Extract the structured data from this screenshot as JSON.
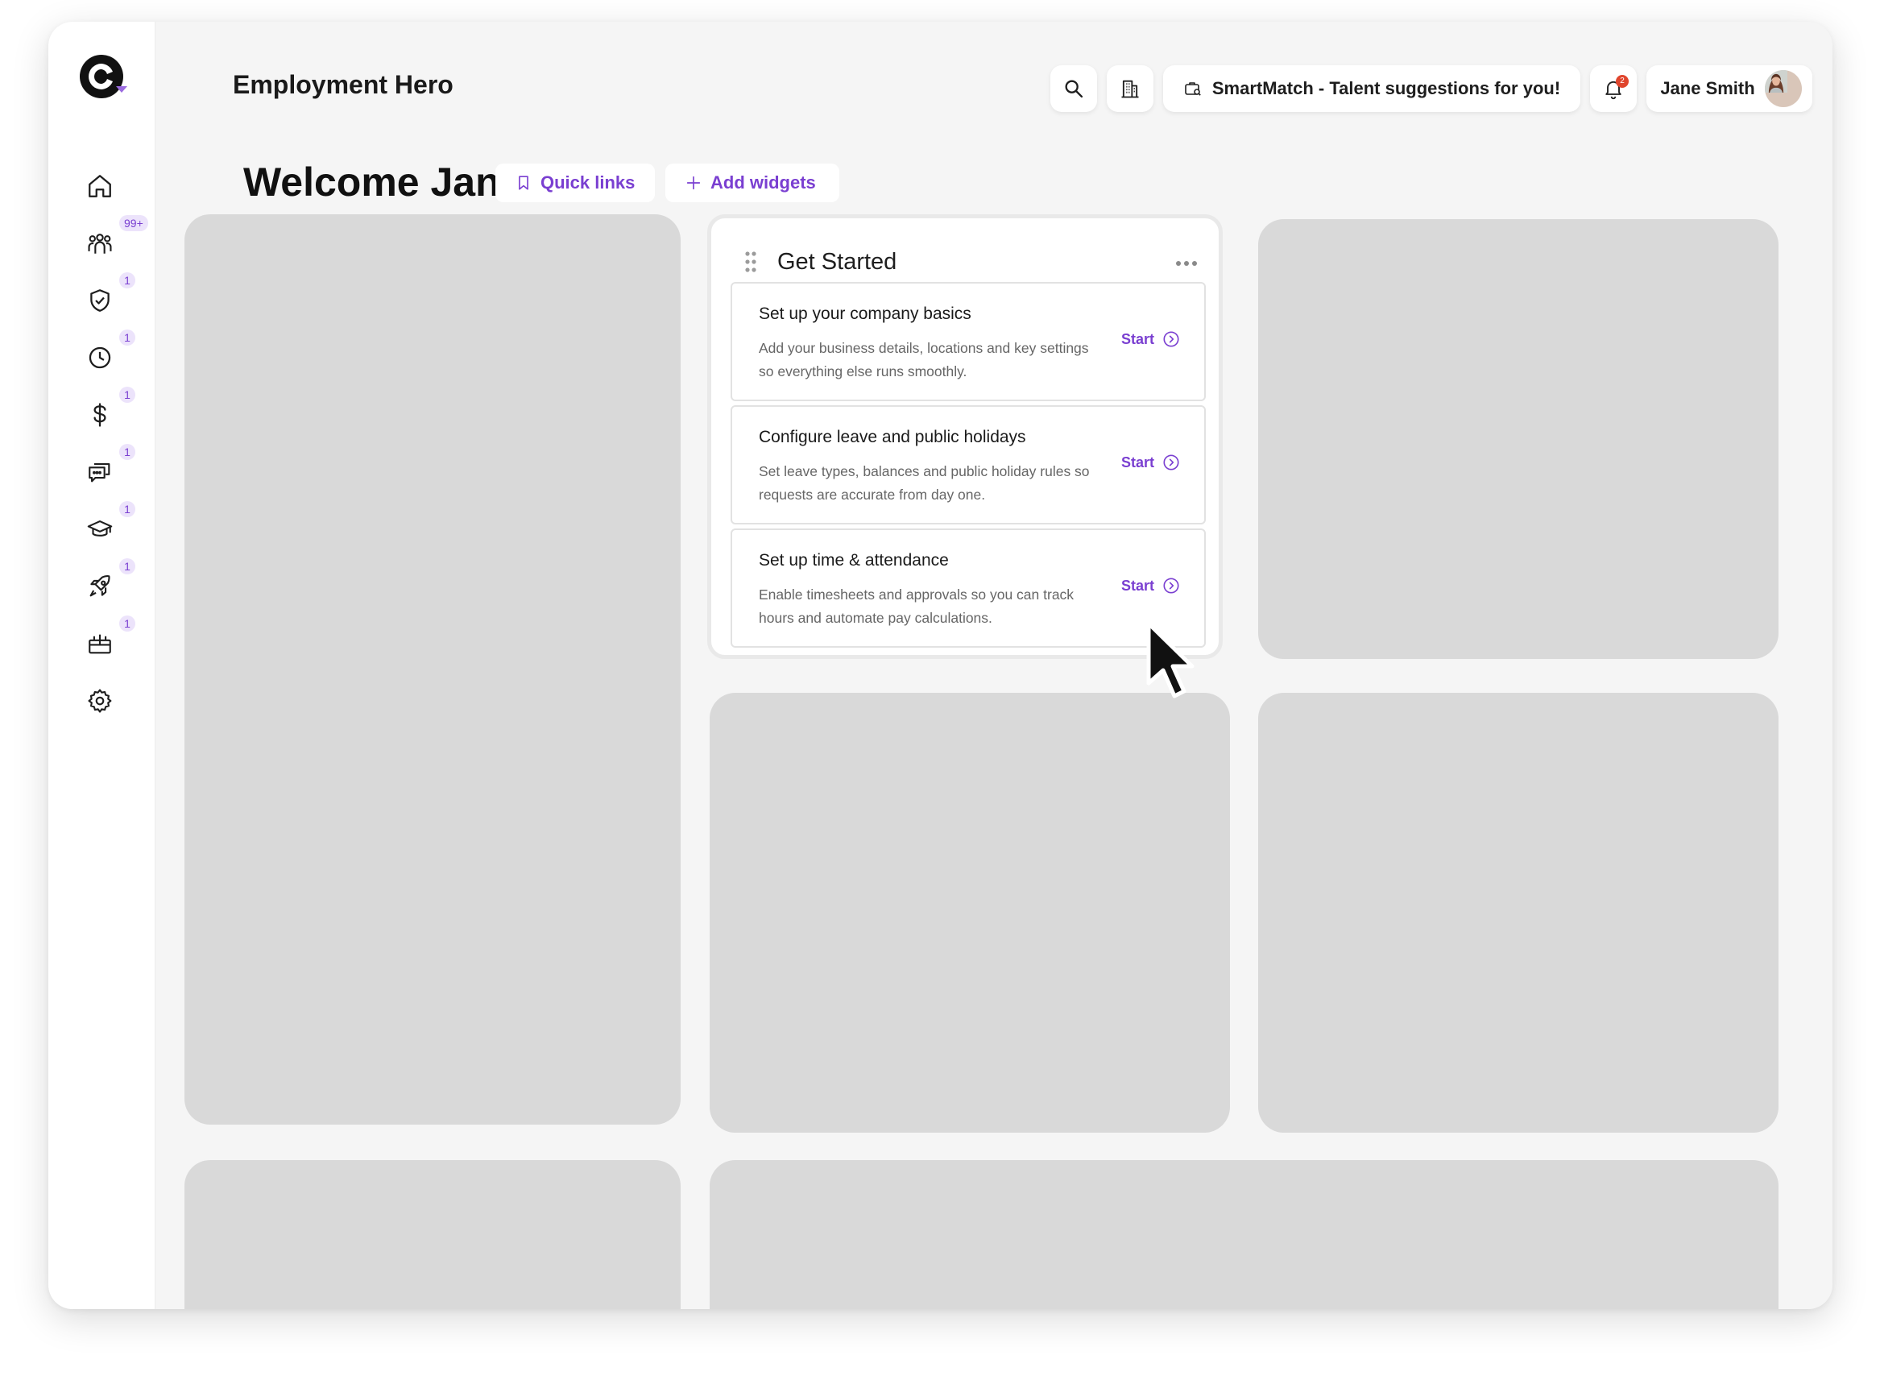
{
  "app": {
    "title": "Employment Hero"
  },
  "sidebar": {
    "items": [
      {
        "icon": "home-icon",
        "badge": ""
      },
      {
        "icon": "people-icon",
        "badge": "99+"
      },
      {
        "icon": "shield-check-icon",
        "badge": "1"
      },
      {
        "icon": "clock-icon",
        "badge": "1"
      },
      {
        "icon": "dollar-icon",
        "badge": "1"
      },
      {
        "icon": "chat-icon",
        "badge": "1"
      },
      {
        "icon": "graduation-cap-icon",
        "badge": "1"
      },
      {
        "icon": "rocket-icon",
        "badge": "1"
      },
      {
        "icon": "gift-icon",
        "badge": "1"
      },
      {
        "icon": "gear-icon",
        "badge": ""
      }
    ]
  },
  "header": {
    "smartmatch_label": "SmartMatch - Talent suggestions for you!",
    "notifications_count": "2",
    "user_name": "Jane Smith"
  },
  "welcome": {
    "title": "Welcome Jane",
    "quick_links_label": "Quick links",
    "add_widgets_label": "Add widgets"
  },
  "get_started": {
    "title": "Get Started",
    "tasks": [
      {
        "title": "Set up your company basics",
        "description": "Add your business details, locations and key settings so everything else runs smoothly.",
        "action": "Start"
      },
      {
        "title": "Configure leave and public holidays",
        "description": "Set leave types, balances and public holiday rules so requests are accurate from day one.",
        "action": "Start"
      },
      {
        "title": "Set up time & attendance",
        "description": "Enable timesheets and approvals so you can track hours and automate pay calculations.",
        "action": "Start"
      }
    ]
  },
  "colors": {
    "accent": "#7a3fd1",
    "badge_bg": "#ece3fb",
    "placeholder": "#d9d9d9",
    "notification": "#e0452d"
  }
}
